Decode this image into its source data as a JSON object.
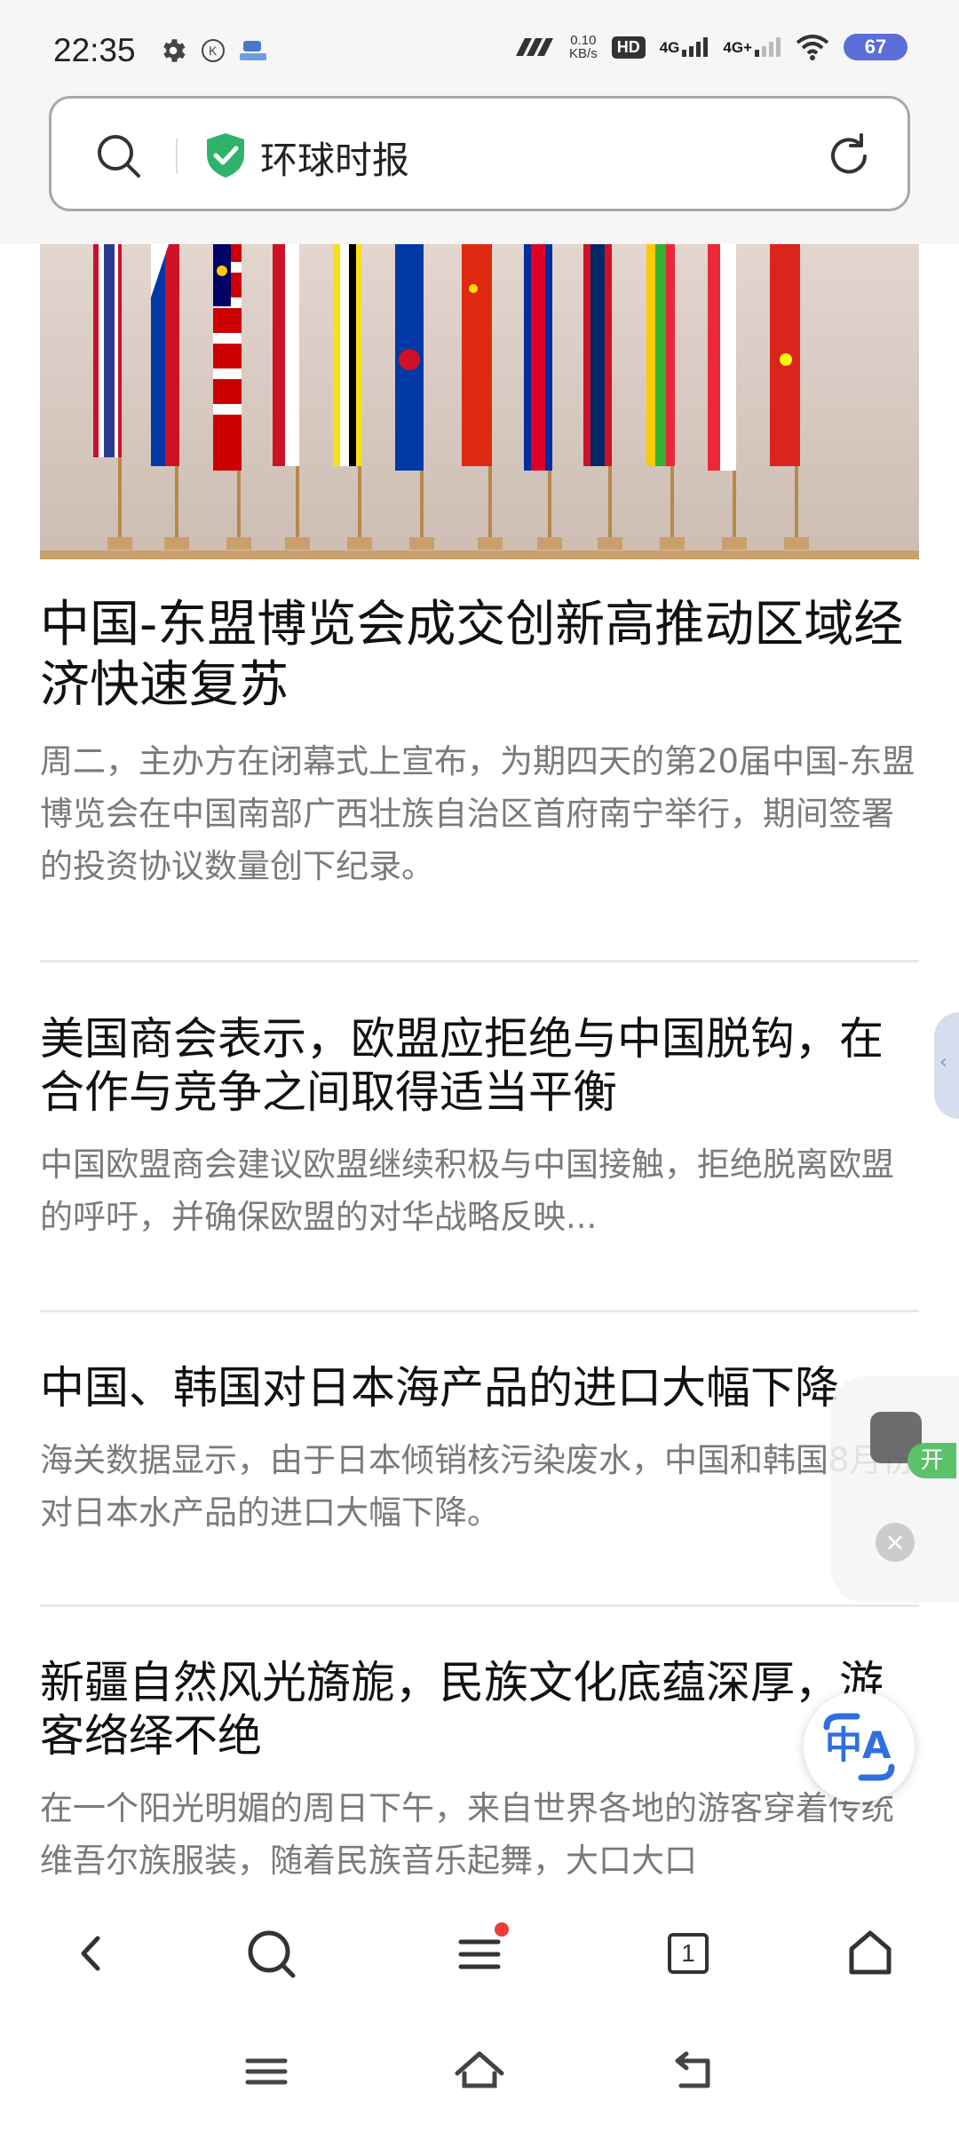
{
  "status_bar": {
    "time": "22:35",
    "net_speed_value": "0.10",
    "net_speed_unit": "KB/s",
    "hd_label": "HD",
    "sim1_label": "4G",
    "sim2_label": "4G+",
    "battery": "67",
    "icons": [
      "gear-icon",
      "k-badge-icon",
      "app-notification-icon",
      "signal-icon",
      "wifi-icon"
    ]
  },
  "url_bar": {
    "title": "环球时报",
    "icons": [
      "search-icon",
      "shield-check-icon",
      "refresh-icon"
    ]
  },
  "articles": [
    {
      "title": "中国-东盟博览会成交创新高推动区域经济快速复苏",
      "summary": "周二，主办方在闭幕式上宣布，为期四天的第20届中国-东盟博览会在中国南部广西壮族自治区首府南宁举行，期间签署的投资协议数量创下纪录。"
    },
    {
      "title": "美国商会表示，欧盟应拒绝与中国脱钩，在合作与竞争之间取得适当平衡",
      "summary": "中国欧盟商会建议欧盟继续积极与中国接触，拒绝脱离欧盟的呼吁，并确保欧盟的对华战略反映..."
    },
    {
      "title": "中国、韩国对日本海产品的进口大幅下降",
      "summary": "海关数据显示，由于日本倾销核污染废水，中国和韩国8月份对日本水产品的进口大幅下降。"
    },
    {
      "title": "新疆自然风光旖旎，民族文化底蕴深厚，游客络绎不绝",
      "summary": "在一个阳光明媚的周日下午，来自世界各地的游客穿着传统维吾尔族服装，随着民族音乐起舞，大口大口"
    }
  ],
  "floating": {
    "open_label": "开",
    "close_label": "×",
    "translate_label": "中A"
  },
  "toolbar": {
    "tab_count": "1",
    "icons": [
      "back-icon",
      "search-icon",
      "menu-icon",
      "tabs-icon",
      "home-icon"
    ]
  },
  "colors": {
    "accent_green": "#2fb36b",
    "red_dot": "#ee3b3b",
    "battery_blue": "#5b6dd9",
    "translate_blue": "#2f6fe0"
  }
}
